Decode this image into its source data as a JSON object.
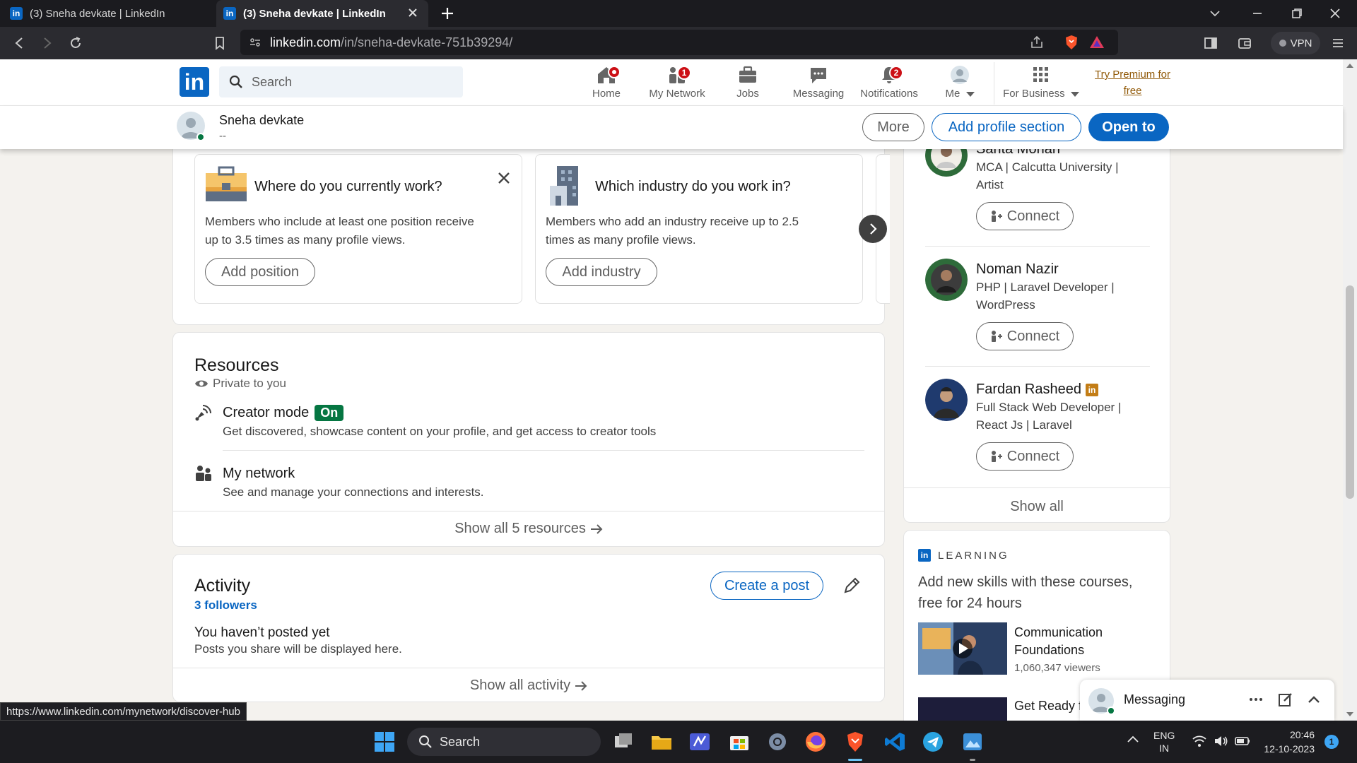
{
  "browser": {
    "tabs": [
      {
        "title": "(3) Sneha devkate | LinkedIn",
        "active": false
      },
      {
        "title": "(3) Sneha devkate | LinkedIn",
        "active": true
      }
    ],
    "url_host": "linkedin.com",
    "url_path": "/in/sneha-devkate-751b39294/",
    "vpn_label": "VPN",
    "status_url": "https://www.linkedin.com/mynetwork/discover-hub"
  },
  "linkedin_nav": {
    "logo_text": "in",
    "search_placeholder": "Search",
    "items": [
      {
        "label": "Home",
        "icon": "home-icon",
        "badge": ""
      },
      {
        "label": "My Network",
        "icon": "network-icon",
        "badge": "1"
      },
      {
        "label": "Jobs",
        "icon": "briefcase-icon",
        "badge": ""
      },
      {
        "label": "Messaging",
        "icon": "chat-icon",
        "badge": ""
      },
      {
        "label": "Notifications",
        "icon": "bell-icon",
        "badge": "2"
      },
      {
        "label": "Me",
        "icon": "avatar-icon",
        "badge": ""
      },
      {
        "label": "For Business",
        "icon": "grid-icon",
        "badge": ""
      }
    ],
    "premium_line1": "Try Premium for",
    "premium_line2": "free",
    "accent": "#0a66c2"
  },
  "profile_bar": {
    "name": "Sneha devkate",
    "headline": "--",
    "more_label": "More",
    "add_section_label": "Add profile section",
    "open_to_label": "Open to"
  },
  "suggestions": {
    "cards": [
      {
        "title": "Where do you currently work?",
        "desc_line1": "Members who include at least one position receive",
        "desc_line2": "up to 3.5 times as many profile views.",
        "button": "Add position"
      },
      {
        "title": "Which industry do you work in?",
        "desc_line1": "Members who add an industry receive up to 2.5",
        "desc_line2": "times as many profile views.",
        "button": "Add industry"
      }
    ]
  },
  "resources": {
    "title": "Resources",
    "private_note": "Private to you",
    "items": [
      {
        "title": "Creator mode",
        "badge": "On",
        "desc": "Get discovered, showcase content on your profile, and get access to creator tools"
      },
      {
        "title": "My network",
        "desc": "See and manage your connections and interests."
      }
    ],
    "show_all": "Show all 5 resources"
  },
  "activity": {
    "title": "Activity",
    "followers": "3 followers",
    "create_post": "Create a post",
    "empty_title": "You haven’t posted yet",
    "empty_desc": "Posts you share will be displayed here.",
    "show_all": "Show all activity"
  },
  "people": {
    "items": [
      {
        "name": "Sarita Mohan",
        "headline_line1": "MCA | Calcutta University |",
        "headline_line2": "Artist",
        "button": "Connect"
      },
      {
        "name": "Noman Nazir",
        "headline_line1": "PHP | Laravel Developer |",
        "headline_line2": "WordPress",
        "button": "Connect"
      },
      {
        "name": "Fardan Rasheed",
        "headline_line1": "Full Stack Web Developer |",
        "headline_line2": "React Js | Laravel",
        "button": "Connect"
      }
    ],
    "show_all": "Show all"
  },
  "learning": {
    "label": "LEARNING",
    "desc_line1": "Add new skills with these courses,",
    "desc_line2": "free for 24 hours",
    "course1_line1": "Communication",
    "course1_line2": "Foundations",
    "course1_viewers": "1,060,347 viewers",
    "course2_title": "Get Ready f"
  },
  "messaging": {
    "label": "Messaging"
  },
  "taskbar": {
    "search": "Search",
    "lang1": "ENG",
    "lang2": "IN",
    "time": "20:46",
    "date": "12-10-2023",
    "notif_count": "1"
  }
}
